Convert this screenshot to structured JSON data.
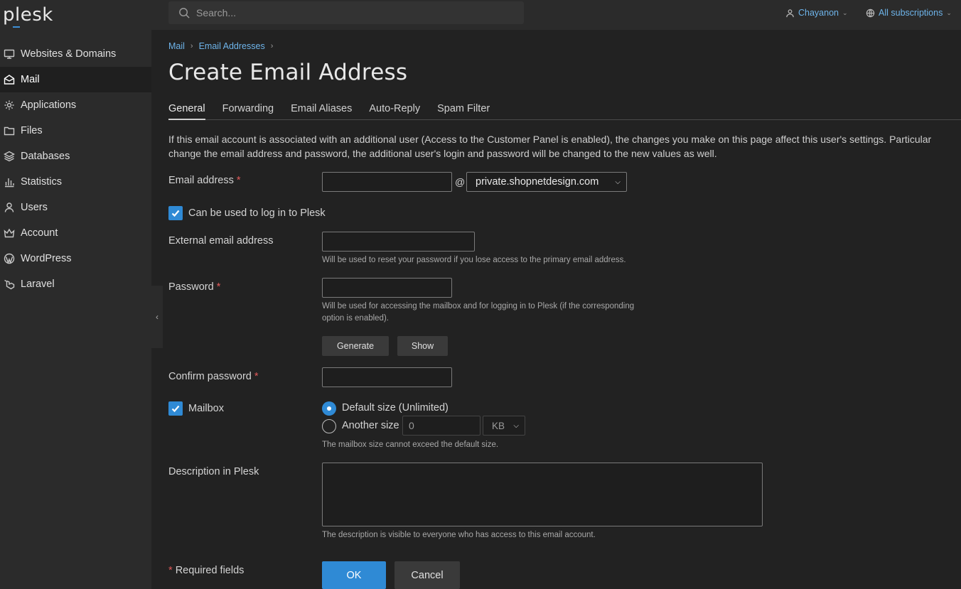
{
  "app": {
    "logo": "plesk"
  },
  "topbar": {
    "search_placeholder": "Search...",
    "user_name": "Chayanon",
    "subscriptions_label": "All subscriptions"
  },
  "sidebar": {
    "items": [
      {
        "label": "Websites & Domains",
        "icon": "monitor-icon"
      },
      {
        "label": "Mail",
        "icon": "mail-icon",
        "active": true
      },
      {
        "label": "Applications",
        "icon": "gear-icon"
      },
      {
        "label": "Files",
        "icon": "folder-icon"
      },
      {
        "label": "Databases",
        "icon": "layers-icon"
      },
      {
        "label": "Statistics",
        "icon": "bar-chart-icon"
      },
      {
        "label": "Users",
        "icon": "user-icon"
      },
      {
        "label": "Account",
        "icon": "crown-icon"
      },
      {
        "label": "WordPress",
        "icon": "wordpress-icon"
      },
      {
        "label": "Laravel",
        "icon": "laravel-icon"
      }
    ]
  },
  "breadcrumb": [
    "Mail",
    "Email Addresses"
  ],
  "page_title": "Create Email Address",
  "tabs": [
    {
      "label": "General",
      "active": true
    },
    {
      "label": "Forwarding"
    },
    {
      "label": "Email Aliases"
    },
    {
      "label": "Auto-Reply"
    },
    {
      "label": "Spam Filter"
    }
  ],
  "notice": {
    "line1": "If this email account is associated with an additional user (Access to the Customer Panel is enabled), the changes you make on this page affect this user's settings. Particular",
    "line2": "change the email address and password, the additional user's login and password will be changed to the new values as well."
  },
  "form": {
    "email_label": "Email address",
    "required_mark": "*",
    "at_sign": "@",
    "email_value": "",
    "domain_selected": "private.shopnetdesign.com",
    "login_checkbox_label": "Can be used to log in to Plesk",
    "login_checked": true,
    "external_label": "External email address",
    "external_value": "",
    "external_hint": "Will be used to reset your password if you lose access to the primary email address.",
    "password_label": "Password",
    "password_hint_1": "Will be used for accessing the mailbox and for logging in to Plesk (if the corresponding",
    "password_hint_2": "option is enabled).",
    "generate_button": "Generate",
    "show_button": "Show",
    "confirm_label": "Confirm password",
    "mailbox_label": "Mailbox",
    "mailbox_checked": true,
    "default_size_label": "Default size (Unlimited)",
    "another_size_label": "Another size",
    "another_size_value": "0",
    "size_unit": "KB",
    "mailbox_hint": "The mailbox size cannot exceed the default size.",
    "description_label": "Description in Plesk",
    "description_hint": "The description is visible to everyone who has access to this email account.",
    "required_fields_label": "Required fields",
    "ok_button": "OK",
    "cancel_button": "Cancel"
  },
  "colors": {
    "accent": "#2f8ad5",
    "link": "#6eb4ea",
    "background": "#222222",
    "sidebar": "#2b2b2b"
  }
}
